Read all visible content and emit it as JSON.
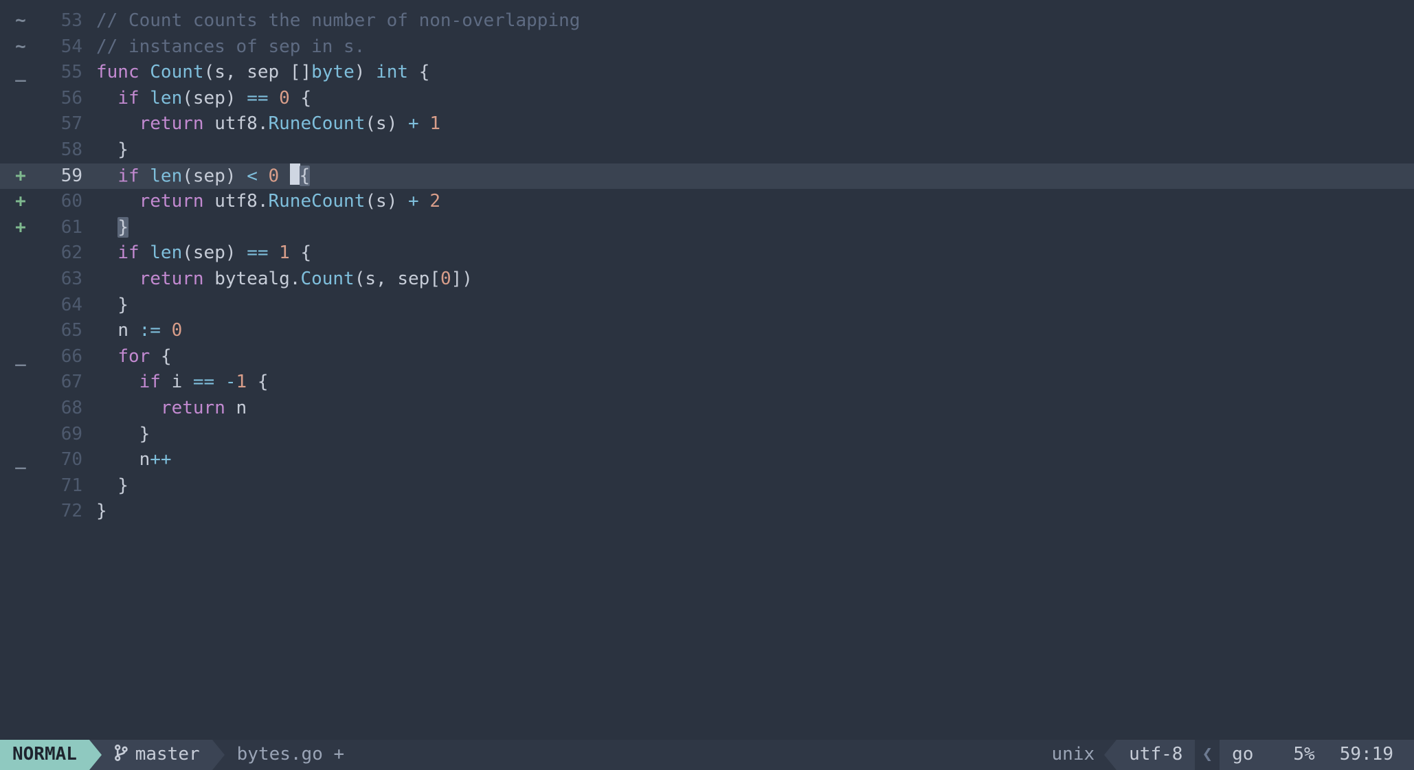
{
  "editor": {
    "lines": [
      {
        "num": 53,
        "sign": "~",
        "sign_kind": "mod",
        "current": false,
        "tokens": [
          {
            "t": "// Count counts the number of non-overlapping",
            "c": "cmt"
          }
        ]
      },
      {
        "num": 54,
        "sign": "~",
        "sign_kind": "mod",
        "current": false,
        "tokens": [
          {
            "t": "// instances of sep in s.",
            "c": "cmt"
          }
        ]
      },
      {
        "num": 55,
        "sign": "_",
        "sign_kind": "fold",
        "current": false,
        "tokens": [
          {
            "t": "func ",
            "c": "kw"
          },
          {
            "t": "Count",
            "c": "fn"
          },
          {
            "t": "(",
            "c": "pn"
          },
          {
            "t": "s",
            "c": "id"
          },
          {
            "t": ", ",
            "c": "pn"
          },
          {
            "t": "sep ",
            "c": "id"
          },
          {
            "t": "[]",
            "c": "pn"
          },
          {
            "t": "byte",
            "c": "ty"
          },
          {
            "t": ") ",
            "c": "pn"
          },
          {
            "t": "int ",
            "c": "ty"
          },
          {
            "t": "{",
            "c": "pn"
          }
        ]
      },
      {
        "num": 56,
        "sign": "",
        "sign_kind": "",
        "current": false,
        "tokens": [
          {
            "t": "  ",
            "c": "pn"
          },
          {
            "t": "if ",
            "c": "kw"
          },
          {
            "t": "len",
            "c": "fn"
          },
          {
            "t": "(",
            "c": "pn"
          },
          {
            "t": "sep",
            "c": "id"
          },
          {
            "t": ") ",
            "c": "pn"
          },
          {
            "t": "== ",
            "c": "op"
          },
          {
            "t": "0 ",
            "c": "nm"
          },
          {
            "t": "{",
            "c": "pn"
          }
        ]
      },
      {
        "num": 57,
        "sign": "",
        "sign_kind": "",
        "current": false,
        "tokens": [
          {
            "t": "    ",
            "c": "pn"
          },
          {
            "t": "return ",
            "c": "kw"
          },
          {
            "t": "utf8",
            "c": "id"
          },
          {
            "t": ".",
            "c": "pn"
          },
          {
            "t": "RuneCount",
            "c": "fn"
          },
          {
            "t": "(",
            "c": "pn"
          },
          {
            "t": "s",
            "c": "id"
          },
          {
            "t": ") ",
            "c": "pn"
          },
          {
            "t": "+ ",
            "c": "op"
          },
          {
            "t": "1",
            "c": "nm"
          }
        ]
      },
      {
        "num": 58,
        "sign": "",
        "sign_kind": "",
        "current": false,
        "tokens": [
          {
            "t": "  }",
            "c": "pn"
          }
        ]
      },
      {
        "num": 59,
        "sign": "+",
        "sign_kind": "add",
        "current": true,
        "tokens": [
          {
            "t": "  ",
            "c": "pn"
          },
          {
            "t": "if ",
            "c": "kw"
          },
          {
            "t": "len",
            "c": "fn"
          },
          {
            "t": "(",
            "c": "pn"
          },
          {
            "t": "sep",
            "c": "id"
          },
          {
            "t": ") ",
            "c": "pn"
          },
          {
            "t": "< ",
            "c": "op"
          },
          {
            "t": "0 ",
            "c": "nm"
          },
          {
            "t": "",
            "c": "pn",
            "cursor": true
          },
          {
            "t": "{",
            "c": "pn",
            "match": true
          }
        ]
      },
      {
        "num": 60,
        "sign": "+",
        "sign_kind": "add",
        "current": false,
        "tokens": [
          {
            "t": "    ",
            "c": "pn"
          },
          {
            "t": "return ",
            "c": "kw"
          },
          {
            "t": "utf8",
            "c": "id"
          },
          {
            "t": ".",
            "c": "pn"
          },
          {
            "t": "RuneCount",
            "c": "fn"
          },
          {
            "t": "(",
            "c": "pn"
          },
          {
            "t": "s",
            "c": "id"
          },
          {
            "t": ") ",
            "c": "pn"
          },
          {
            "t": "+ ",
            "c": "op"
          },
          {
            "t": "2",
            "c": "nm"
          }
        ]
      },
      {
        "num": 61,
        "sign": "+",
        "sign_kind": "add",
        "current": false,
        "tokens": [
          {
            "t": "  ",
            "c": "pn"
          },
          {
            "t": "}",
            "c": "pn",
            "match": true
          }
        ]
      },
      {
        "num": 62,
        "sign": "",
        "sign_kind": "",
        "current": false,
        "tokens": [
          {
            "t": "  ",
            "c": "pn"
          },
          {
            "t": "if ",
            "c": "kw"
          },
          {
            "t": "len",
            "c": "fn"
          },
          {
            "t": "(",
            "c": "pn"
          },
          {
            "t": "sep",
            "c": "id"
          },
          {
            "t": ") ",
            "c": "pn"
          },
          {
            "t": "== ",
            "c": "op"
          },
          {
            "t": "1 ",
            "c": "nm"
          },
          {
            "t": "{",
            "c": "pn"
          }
        ]
      },
      {
        "num": 63,
        "sign": "",
        "sign_kind": "",
        "current": false,
        "tokens": [
          {
            "t": "    ",
            "c": "pn"
          },
          {
            "t": "return ",
            "c": "kw"
          },
          {
            "t": "bytealg",
            "c": "id"
          },
          {
            "t": ".",
            "c": "pn"
          },
          {
            "t": "Count",
            "c": "fn"
          },
          {
            "t": "(",
            "c": "pn"
          },
          {
            "t": "s",
            "c": "id"
          },
          {
            "t": ", ",
            "c": "pn"
          },
          {
            "t": "sep",
            "c": "id"
          },
          {
            "t": "[",
            "c": "pn"
          },
          {
            "t": "0",
            "c": "nm"
          },
          {
            "t": "])",
            "c": "pn"
          }
        ]
      },
      {
        "num": 64,
        "sign": "",
        "sign_kind": "",
        "current": false,
        "tokens": [
          {
            "t": "  }",
            "c": "pn"
          }
        ]
      },
      {
        "num": 65,
        "sign": "",
        "sign_kind": "",
        "current": false,
        "tokens": [
          {
            "t": "  ",
            "c": "pn"
          },
          {
            "t": "n ",
            "c": "id"
          },
          {
            "t": ":= ",
            "c": "op"
          },
          {
            "t": "0",
            "c": "nm"
          }
        ]
      },
      {
        "num": 66,
        "sign": "_",
        "sign_kind": "fold",
        "current": false,
        "tokens": [
          {
            "t": "  ",
            "c": "pn"
          },
          {
            "t": "for ",
            "c": "kw"
          },
          {
            "t": "{",
            "c": "pn"
          }
        ]
      },
      {
        "num": 67,
        "sign": "",
        "sign_kind": "",
        "current": false,
        "tokens": [
          {
            "t": "    ",
            "c": "pn"
          },
          {
            "t": "if ",
            "c": "kw"
          },
          {
            "t": "i ",
            "c": "id"
          },
          {
            "t": "== ",
            "c": "op"
          },
          {
            "t": "-",
            "c": "op"
          },
          {
            "t": "1 ",
            "c": "nm"
          },
          {
            "t": "{",
            "c": "pn"
          }
        ]
      },
      {
        "num": 68,
        "sign": "",
        "sign_kind": "",
        "current": false,
        "tokens": [
          {
            "t": "      ",
            "c": "pn"
          },
          {
            "t": "return ",
            "c": "kw"
          },
          {
            "t": "n",
            "c": "id"
          }
        ]
      },
      {
        "num": 69,
        "sign": "",
        "sign_kind": "",
        "current": false,
        "tokens": [
          {
            "t": "    }",
            "c": "pn"
          }
        ]
      },
      {
        "num": 70,
        "sign": "_",
        "sign_kind": "fold",
        "current": false,
        "tokens": [
          {
            "t": "    ",
            "c": "pn"
          },
          {
            "t": "n",
            "c": "id"
          },
          {
            "t": "++",
            "c": "op"
          }
        ]
      },
      {
        "num": 71,
        "sign": "",
        "sign_kind": "",
        "current": false,
        "tokens": [
          {
            "t": "  }",
            "c": "pn"
          }
        ]
      },
      {
        "num": 72,
        "sign": "",
        "sign_kind": "",
        "current": false,
        "tokens": [
          {
            "t": "}",
            "c": "pn"
          }
        ]
      }
    ]
  },
  "status": {
    "mode": "NORMAL",
    "branch": "master",
    "filename": "bytes.go",
    "modified_flag": "+",
    "fileformat": "unix",
    "encoding": "utf-8",
    "filetype": "go",
    "percent": "5%",
    "position": "59:19"
  }
}
